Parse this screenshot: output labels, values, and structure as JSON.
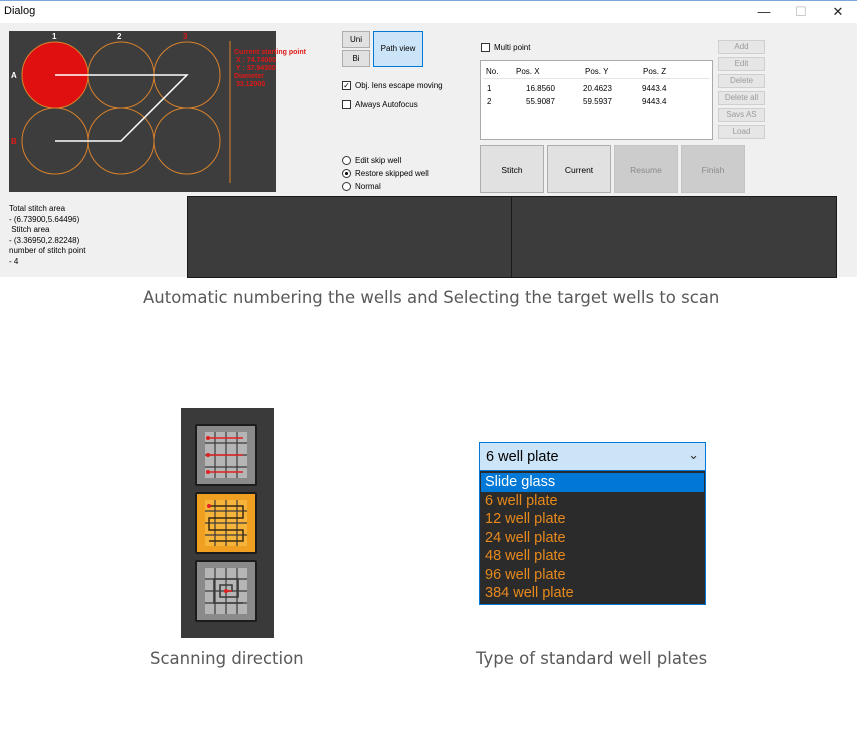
{
  "window": {
    "title": "Dialog",
    "controls": {
      "minimize": "—",
      "maximize": "☐",
      "close": "✕"
    }
  },
  "plate_preview": {
    "column_labels": [
      "1",
      "2",
      "3"
    ],
    "row_labels": [
      "A",
      "B"
    ],
    "info_lines": [
      "Current starting point",
      " X : 74.74000",
      " Y : 37.94300",
      "Diameter",
      " 33.12000"
    ],
    "colors": {
      "active_well": "#e01010",
      "well_outline": "#d9822b",
      "path": "#ffffff",
      "background": "#3d3d3d"
    }
  },
  "scan_mode": {
    "uni": "Uni",
    "bi": "Bi",
    "path_view": "Path view"
  },
  "options": {
    "obj_lens_escape": {
      "label": "Obj. lens escape moving",
      "checked": true
    },
    "always_autofocus": {
      "label": "Always Autofocus",
      "checked": false
    },
    "multi_point": {
      "label": "Multi point",
      "checked": false
    }
  },
  "well_mode": {
    "options": [
      "Edit skip well",
      "Restore skipped well",
      "Normal"
    ],
    "selected": "Restore skipped well"
  },
  "points_table": {
    "headers": [
      "No.",
      "Pos. X",
      "Pos. Y",
      "Pos. Z"
    ],
    "rows": [
      [
        "1",
        "16.8560",
        "20.4623",
        "9443.4"
      ],
      [
        "2",
        "55.9087",
        "59.5937",
        "9443.4"
      ]
    ]
  },
  "side_buttons": [
    "Add",
    "Edit",
    "Delete",
    "Delete all",
    "Savs AS",
    "Load"
  ],
  "action_buttons": {
    "stitch": "Stitch",
    "current": "Current",
    "resume": "Resume",
    "finish": "Finish"
  },
  "stats": {
    "lines": [
      "Total stitch area",
      "- (6.73900,5.64496)",
      " Stitch area",
      "- (3.36950,2.82248)",
      "number of stitch point",
      "- 4"
    ]
  },
  "captions": {
    "top": "Automatic numbering the wells and Selecting the target wells to scan",
    "scan": "Scanning direction",
    "plates": "Type of standard well plates"
  },
  "plate_dropdown": {
    "value": "6 well plate",
    "options": [
      "Slide glass",
      "6 well plate",
      "12 well plate",
      "24 well plate",
      "48 well plate",
      "96 well plate",
      "384 well plate"
    ],
    "highlighted": "Slide glass",
    "colors": {
      "option_text": "#e8891c",
      "highlight": "#0078d7",
      "list_bg": "#2b2b2b"
    }
  },
  "scan_directions": [
    "unidirectional-rows",
    "bidirectional-serpentine",
    "spiral"
  ]
}
